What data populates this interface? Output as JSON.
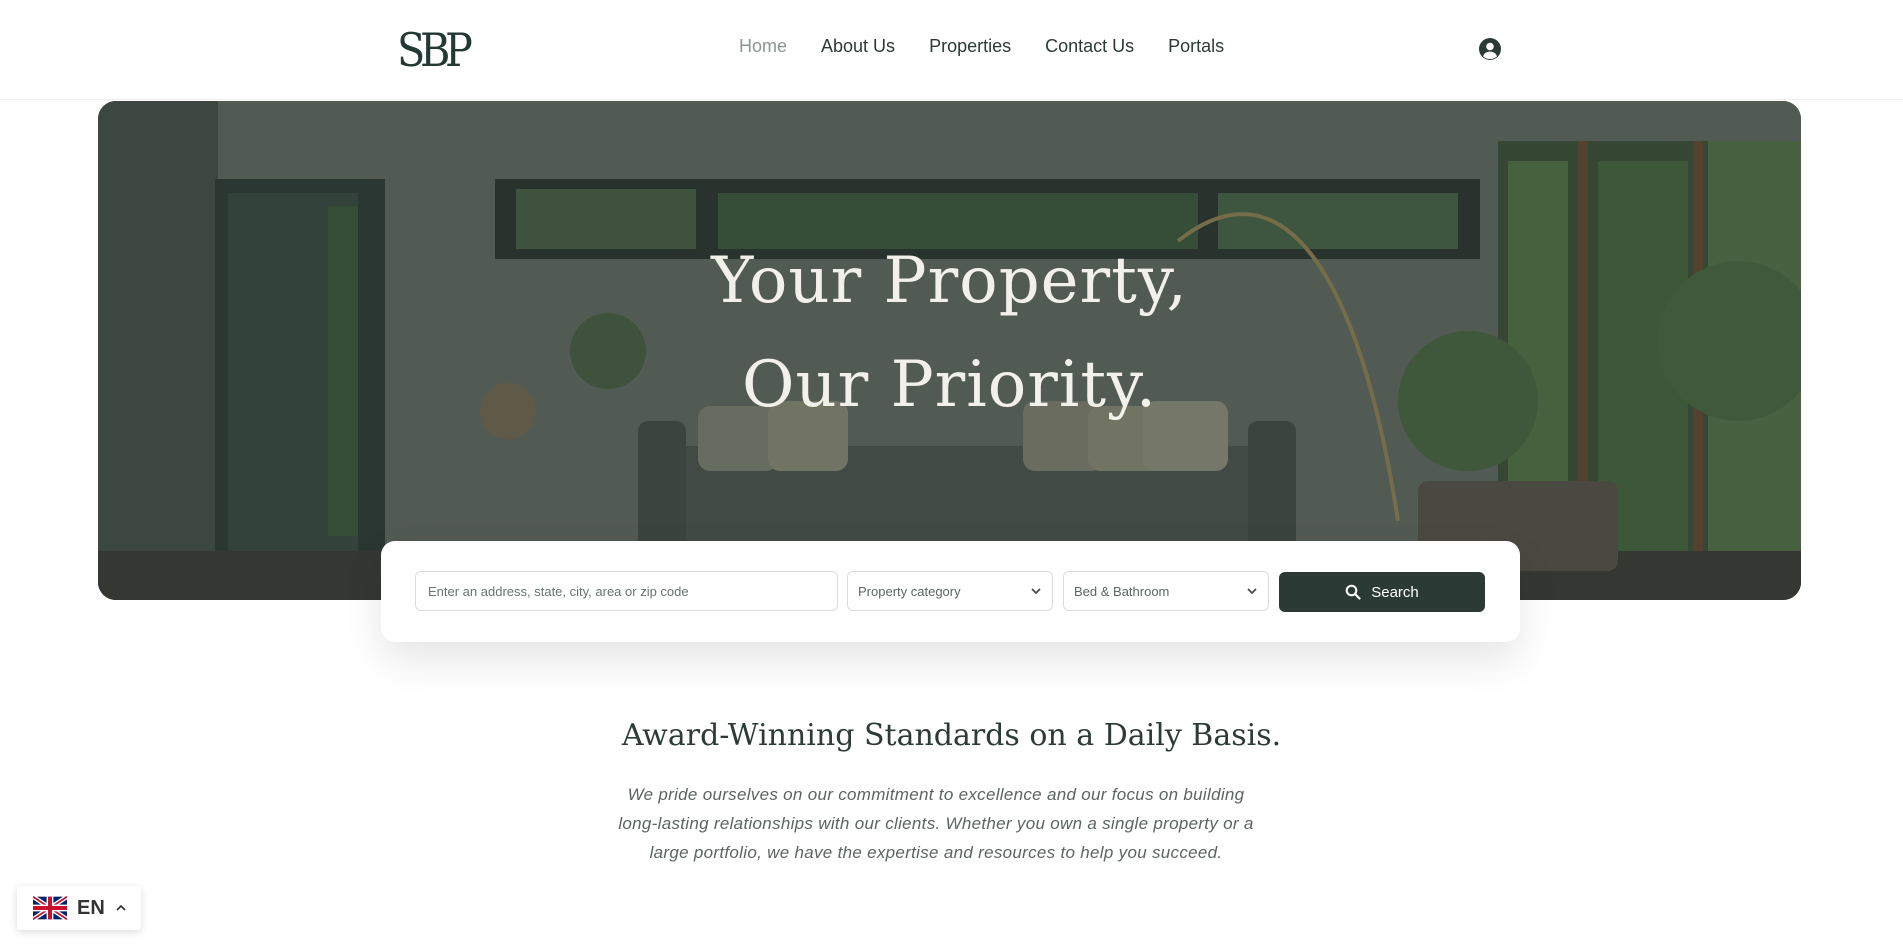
{
  "brand": {
    "logo_text": "SBP"
  },
  "nav": {
    "items": [
      {
        "label": "Home",
        "active": true
      },
      {
        "label": "About Us"
      },
      {
        "label": "Properties"
      },
      {
        "label": "Contact Us"
      },
      {
        "label": "Portals"
      }
    ]
  },
  "hero": {
    "title_line1": "Your Property,",
    "title_line2": "Our Priority."
  },
  "search": {
    "address_placeholder": "Enter an address, state, city, area or zip code",
    "category_label": "Property category",
    "bedbath_label": "Bed & Bathroom",
    "button_label": "Search"
  },
  "intro": {
    "title": "Award-Winning Standards on a Daily Basis.",
    "text": "We pride ourselves on our commitment to excellence and our focus on building long-lasting relationships with our clients. Whether you own a single property or a large portfolio, we have the expertise and resources to help you succeed."
  },
  "language": {
    "code": "EN"
  },
  "colors": {
    "primary": "#2c3a36",
    "nav_active": "#8b9692",
    "text": "#2d3a36"
  }
}
